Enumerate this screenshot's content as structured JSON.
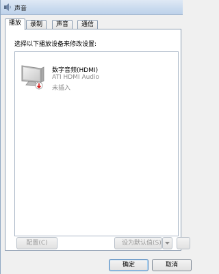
{
  "window": {
    "title": "声音",
    "title_icon": "speaker-icon"
  },
  "tabs": [
    {
      "label": "播放",
      "active": true
    },
    {
      "label": "录制",
      "active": false
    },
    {
      "label": "声音",
      "active": false
    },
    {
      "label": "通信",
      "active": false
    }
  ],
  "panel": {
    "instruction": "选择以下播放设备来修改设置:"
  },
  "devices": [
    {
      "name": "数字音频(HDMI)",
      "driver": "ATI HDMI Audio",
      "status": "未插入",
      "icon": "monitor-icon",
      "status_icon": "red-down-arrow-icon"
    }
  ],
  "buttons": {
    "configure": "配置(C)",
    "set_default": "设为默认值(S)",
    "ok": "确定",
    "cancel": "取消"
  },
  "colors": {
    "status_indicator": "#d11a1a",
    "title_bar": "#c9daee"
  }
}
